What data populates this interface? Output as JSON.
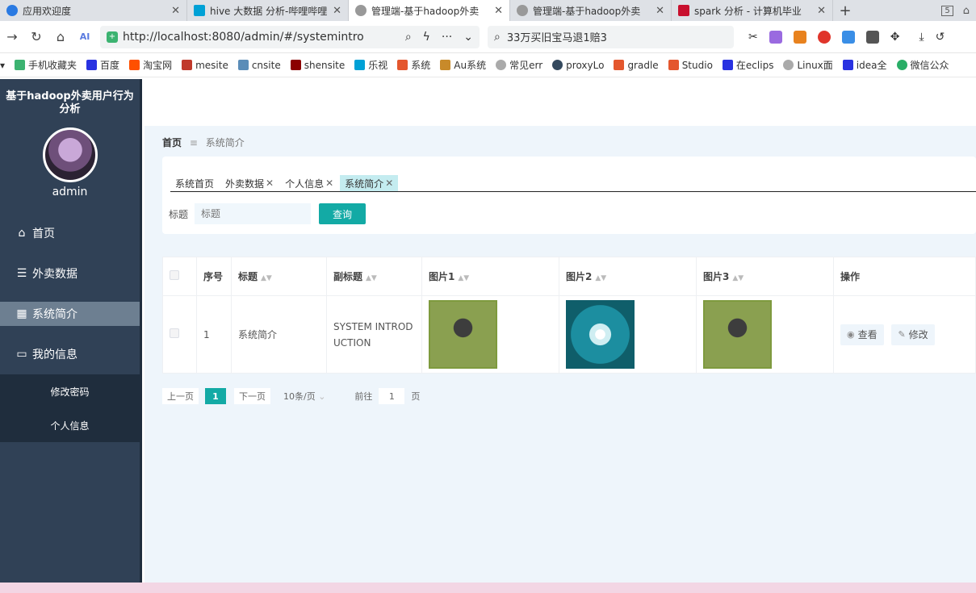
{
  "browser": {
    "tabs": [
      {
        "title": "应用欢迎度",
        "icon_color": "#2a7ae2",
        "active": false
      },
      {
        "title": "hive 大数据 分析-哔哩哔哩",
        "icon_color": "#00a1d6",
        "active": false
      },
      {
        "title": "管理端-基于hadoop外卖",
        "icon_color": "#999999",
        "active": true
      },
      {
        "title": "管理端-基于hadoop外卖",
        "icon_color": "#999999",
        "active": false
      },
      {
        "title": "spark 分析 - 计算机毕业",
        "icon_color": "#c8102e",
        "active": false
      }
    ],
    "tab_count": "5",
    "url_prefix": "http://",
    "url": "http://localhost:8080/admin/#/systemintro",
    "search_text": "33万买旧宝马退1赔3",
    "bookmarks": [
      "手机收藏夹",
      "百度",
      "淘宝网",
      "mesite",
      "cnsite",
      "shensite",
      "乐视",
      "系统",
      "Au系统",
      "常见err",
      "proxyLo",
      "gradle",
      "Studio",
      "在eclips",
      "Linux面",
      "idea全",
      "微信公众"
    ]
  },
  "sidebar": {
    "system_title": "基于hadoop外卖用户行为分析",
    "username": "admin",
    "menu": [
      {
        "label": "首页",
        "icon": "home-icon"
      },
      {
        "label": "外卖数据",
        "icon": "list-icon"
      },
      {
        "label": "系统简介",
        "icon": "grid-icon",
        "active": true
      },
      {
        "label": "我的信息",
        "icon": "profile-icon"
      }
    ],
    "submenu": [
      "修改密码",
      "个人信息"
    ]
  },
  "breadcrumb": {
    "home": "首页",
    "current": "系统简介"
  },
  "tags": [
    {
      "label": "系统首页",
      "closable": false
    },
    {
      "label": "外卖数据",
      "closable": true
    },
    {
      "label": "个人信息",
      "closable": true
    },
    {
      "label": "系统简介",
      "closable": true,
      "active": true
    }
  ],
  "search": {
    "label": "标题",
    "placeholder": "标题",
    "button": "查询"
  },
  "table": {
    "headers": [
      "序号",
      "标题",
      "副标题",
      "图片1",
      "图片2",
      "图片3",
      "操作"
    ],
    "rows": [
      {
        "index": "1",
        "title": "系统简介",
        "subtitle": "SYSTEM INTRODUCTION",
        "view": "查看",
        "edit": "修改"
      }
    ]
  },
  "pager": {
    "prev": "上一页",
    "current": "1",
    "next": "下一页",
    "size": "10条/页",
    "goto": "前往",
    "page_input": "1",
    "page_suffix": "页"
  },
  "colors": {
    "sidebar": "#304156",
    "accent": "#13aaa5",
    "content_bg": "#eef5fb"
  }
}
